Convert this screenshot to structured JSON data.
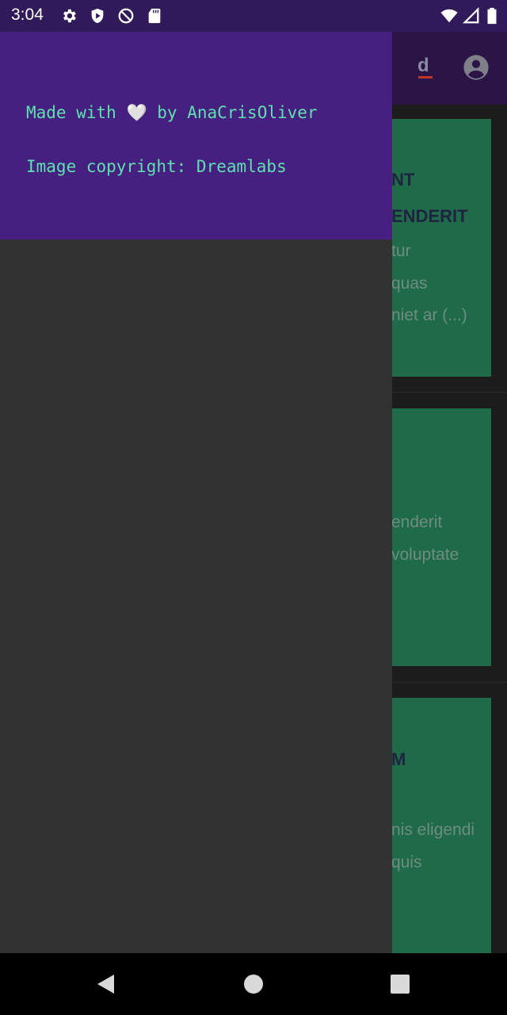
{
  "status_bar": {
    "time": "3:04",
    "left_icons": [
      "gear-icon",
      "play-shield-icon",
      "do-not-disturb-icon",
      "sd-card-icon"
    ],
    "right_icons": [
      "wifi-icon",
      "signal-icon",
      "battery-icon"
    ]
  },
  "app_bar": {
    "logo_icon": "app-logo-icon",
    "account_icon": "account-circle-icon"
  },
  "drawer": {
    "credit_prefix": "Made with",
    "credit_heart": "🤍",
    "credit_suffix": "by AnaCrisOliver",
    "copyright": "Image copyright: Dreamlabs"
  },
  "cards": [
    {
      "title_lines": [
        "NT",
        "ENDERIT"
      ],
      "body_lines": [
        "tur",
        "quas",
        "niet ar (...)"
      ]
    },
    {
      "title_lines": [],
      "body_lines": [
        "enderit",
        "voluptate"
      ]
    },
    {
      "title_lines": [
        "M"
      ],
      "body_lines": [
        "nis eligendi",
        "quis"
      ]
    }
  ],
  "nav_bar": {
    "buttons": [
      "back-icon",
      "home-icon",
      "recents-icon"
    ]
  },
  "colors": {
    "status_bar": "#311a5a",
    "drawer_header": "#462080",
    "drawer_body": "#323232",
    "drawer_text": "#5ee0b0",
    "card": "#1f6a48"
  }
}
